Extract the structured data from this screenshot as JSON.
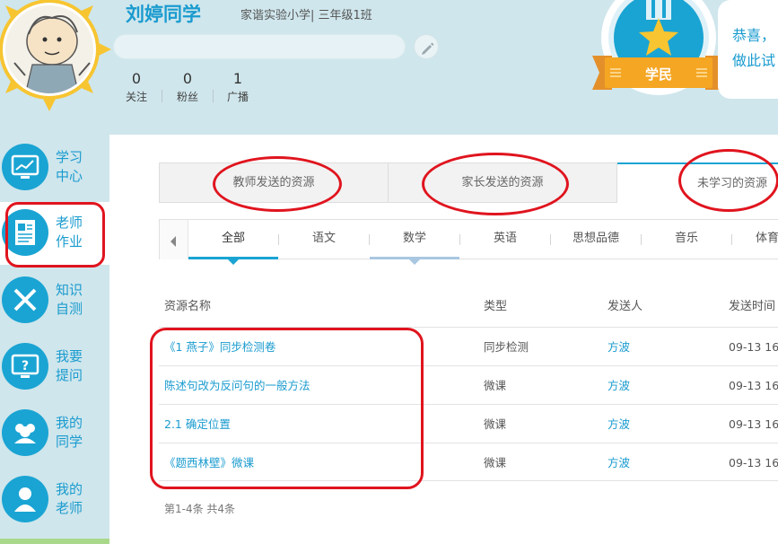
{
  "profile": {
    "name": "刘婷同学",
    "school": "家谐实验小学| 三年级1班",
    "stats": [
      {
        "count": "0",
        "label": "关注"
      },
      {
        "count": "0",
        "label": "粉丝"
      },
      {
        "count": "1",
        "label": "广播"
      }
    ],
    "badge_label": "学民",
    "congrats_line1": "恭喜，",
    "congrats_line2": "做此试"
  },
  "sidebar": {
    "items": [
      {
        "label": "学习中心",
        "icon": "monitor-chart-icon"
      },
      {
        "label": "老师作业",
        "icon": "document-icon"
      },
      {
        "label": "知识自测",
        "icon": "pencil-ruler-icon"
      },
      {
        "label": "我要提问",
        "icon": "question-screen-icon"
      },
      {
        "label": "我的同学",
        "icon": "group-icon"
      },
      {
        "label": "我的老师",
        "icon": "teacher-icon"
      }
    ],
    "active_index": 1
  },
  "tabs": [
    "教师发送的资源",
    "家长发送的资源",
    "未学习的资源"
  ],
  "subjects": [
    "全部",
    "语文",
    "数学",
    "英语",
    "思想品德",
    "音乐",
    "体育"
  ],
  "table": {
    "headers": [
      "资源名称",
      "类型",
      "发送人",
      "发送时间"
    ],
    "rows": [
      {
        "name": "《1 燕子》同步检测卷",
        "type": "同步检测",
        "sender": "方波",
        "time": "09-13 16:"
      },
      {
        "name": "陈述句改为反问句的一般方法",
        "type": "微课",
        "sender": "方波",
        "time": "09-13 16:"
      },
      {
        "name": "2.1 确定位置",
        "type": "微课",
        "sender": "方波",
        "time": "09-13 16:"
      },
      {
        "name": "《题西林壁》微课",
        "type": "微课",
        "sender": "方波",
        "time": "09-13 16:"
      }
    ]
  },
  "pager": "第1-4条 共4条",
  "colors": {
    "accent": "#1a9bcf",
    "header_bg": "#cfe6ec",
    "annotation": "#e0141e",
    "badge_orange": "#f5a623"
  }
}
